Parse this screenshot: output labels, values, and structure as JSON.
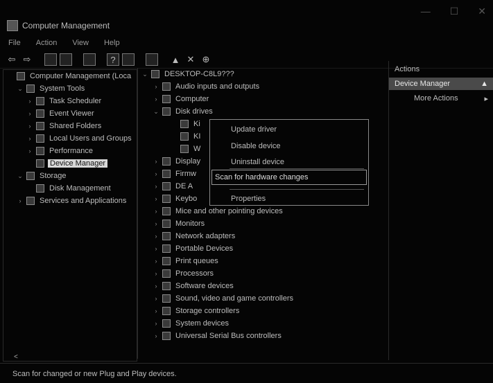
{
  "window": {
    "title": "Computer Management",
    "controls": [
      "—",
      "☐",
      "✕"
    ]
  },
  "menubar": [
    "File",
    "Action",
    "View",
    "Help"
  ],
  "toolbar": {
    "icons": [
      "back-icon",
      "forward-icon",
      "up-folder-icon",
      "show-hide-tree-icon",
      "properties-icon",
      "help-icon",
      "show-action-pane-icon",
      "scan-icon",
      "enable-device-icon",
      "uninstall-icon",
      "update-driver-icon"
    ]
  },
  "left_tree": [
    {
      "label": "Computer Management (Loca",
      "level": 0,
      "chevron": ""
    },
    {
      "label": "System Tools",
      "level": 1,
      "chevron": "v"
    },
    {
      "label": "Task Scheduler",
      "level": 2,
      "chevron": ">"
    },
    {
      "label": "Event Viewer",
      "level": 2,
      "chevron": ">"
    },
    {
      "label": "Shared Folders",
      "level": 2,
      "chevron": ">"
    },
    {
      "label": "Local Users and Groups",
      "level": 2,
      "chevron": ">"
    },
    {
      "label": "Performance",
      "level": 2,
      "chevron": ">"
    },
    {
      "label": "Device Manager",
      "level": 2,
      "chevron": "",
      "selected": true
    },
    {
      "label": "Storage",
      "level": 1,
      "chevron": "v"
    },
    {
      "label": "Disk Management",
      "level": 2,
      "chevron": ""
    },
    {
      "label": "Services and Applications",
      "level": 1,
      "chevron": ">"
    }
  ],
  "device_tree": {
    "root": "DESKTOP-C8L9???",
    "items": [
      {
        "label": "Audio inputs and outputs",
        "chevron": ">"
      },
      {
        "label": "Computer",
        "chevron": ">"
      },
      {
        "label": "Disk drives",
        "chevron": "v"
      },
      {
        "label": "Ki",
        "chevron": "",
        "child": true
      },
      {
        "label": "KI",
        "chevron": "",
        "child": true
      },
      {
        "label": "W",
        "chevron": "",
        "child": true
      },
      {
        "label": "Display",
        "chevron": ">"
      },
      {
        "label": "Firmw",
        "chevron": ">"
      },
      {
        "label": "DE A",
        "chevron": ">"
      },
      {
        "label": "Keybo",
        "chevron": ">"
      },
      {
        "label": "Mice and other pointing devices",
        "chevron": ">"
      },
      {
        "label": "Monitors",
        "chevron": ">"
      },
      {
        "label": "Network adapters",
        "chevron": ">"
      },
      {
        "label": "Portable Devices",
        "chevron": ">"
      },
      {
        "label": "Print queues",
        "chevron": ">"
      },
      {
        "label": "Processors",
        "chevron": ">"
      },
      {
        "label": "Software devices",
        "chevron": ">"
      },
      {
        "label": "Sound, video and game controllers",
        "chevron": ">"
      },
      {
        "label": "Storage controllers",
        "chevron": ">"
      },
      {
        "label": "System devices",
        "chevron": ">"
      },
      {
        "label": "Universal Serial Bus controllers",
        "chevron": ">"
      }
    ]
  },
  "context_menu": {
    "update": "Update driver",
    "disable": "Disable device",
    "uninstall": "Uninstall device",
    "scan": "Scan for hardware changes",
    "properties": "Properties"
  },
  "actions": {
    "header": "Actions",
    "section": "Device Manager",
    "section_arrow": "▲",
    "more": "More Actions",
    "more_arrow": "▸"
  },
  "status": "Scan for changed or new Plug and Play devices.",
  "scroll_left_arrow": "<"
}
